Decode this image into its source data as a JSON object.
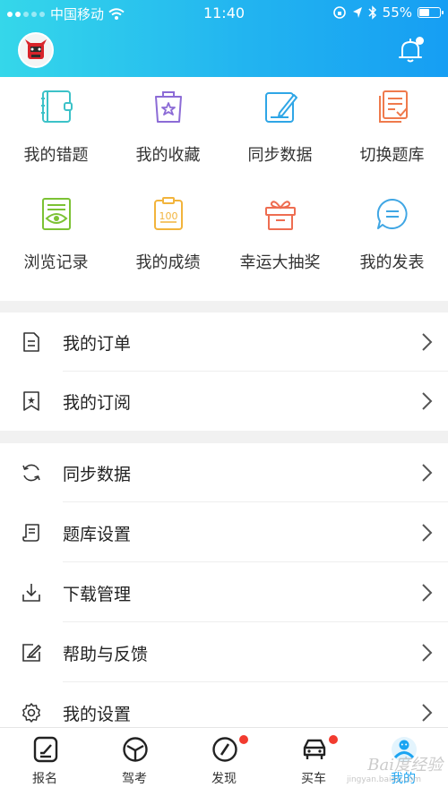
{
  "status_bar": {
    "carrier": "中国移动",
    "time": "11:40",
    "battery": "55%",
    "battery_level": 0.55
  },
  "header": {
    "avatar_icon": "user-avatar-icon",
    "notification_icon": "bell-icon",
    "colors": {
      "gradient_start": "#35d7ea",
      "gradient_end": "#169ef3"
    }
  },
  "grid": [
    {
      "label": "我的错题",
      "icon": "notebook-icon",
      "color": "#3cc2c8"
    },
    {
      "label": "我的收藏",
      "icon": "star-bag-icon",
      "color": "#8c6bd6"
    },
    {
      "label": "同步数据",
      "icon": "edit-sync-icon",
      "color": "#2fa6e6"
    },
    {
      "label": "切换题库",
      "icon": "switch-bank-icon",
      "color": "#ef7a4c"
    },
    {
      "label": "浏览记录",
      "icon": "eye-record-icon",
      "color": "#7cc234"
    },
    {
      "label": "我的成绩",
      "icon": "score-100-icon",
      "color": "#f2b43c"
    },
    {
      "label": "幸运大抽奖",
      "icon": "gift-icon",
      "color": "#ee6d51"
    },
    {
      "label": "我的发表",
      "icon": "comment-icon",
      "color": "#3fa6e4"
    }
  ],
  "menu_group_1": [
    {
      "label": "我的订单",
      "icon": "order-doc-icon"
    },
    {
      "label": "我的订阅",
      "icon": "subscribe-bookmark-icon"
    }
  ],
  "menu_group_2": [
    {
      "label": "同步数据",
      "icon": "sync-icon"
    },
    {
      "label": "题库设置",
      "icon": "bank-settings-icon"
    },
    {
      "label": "下载管理",
      "icon": "download-icon"
    },
    {
      "label": "帮助与反馈",
      "icon": "feedback-icon"
    },
    {
      "label": "我的设置",
      "icon": "gear-icon"
    }
  ],
  "tabbar": [
    {
      "label": "报名",
      "icon": "signup-icon",
      "badge": false,
      "active": false
    },
    {
      "label": "驾考",
      "icon": "steering-wheel-icon",
      "badge": false,
      "active": false
    },
    {
      "label": "发现",
      "icon": "compass-icon",
      "badge": true,
      "active": false
    },
    {
      "label": "买车",
      "icon": "car-icon",
      "badge": true,
      "active": false
    },
    {
      "label": "我的",
      "icon": "profile-icon",
      "badge": false,
      "active": true
    }
  ],
  "watermark": {
    "text": "Bai度经验",
    "sub": "jingyan.baidu.com"
  }
}
